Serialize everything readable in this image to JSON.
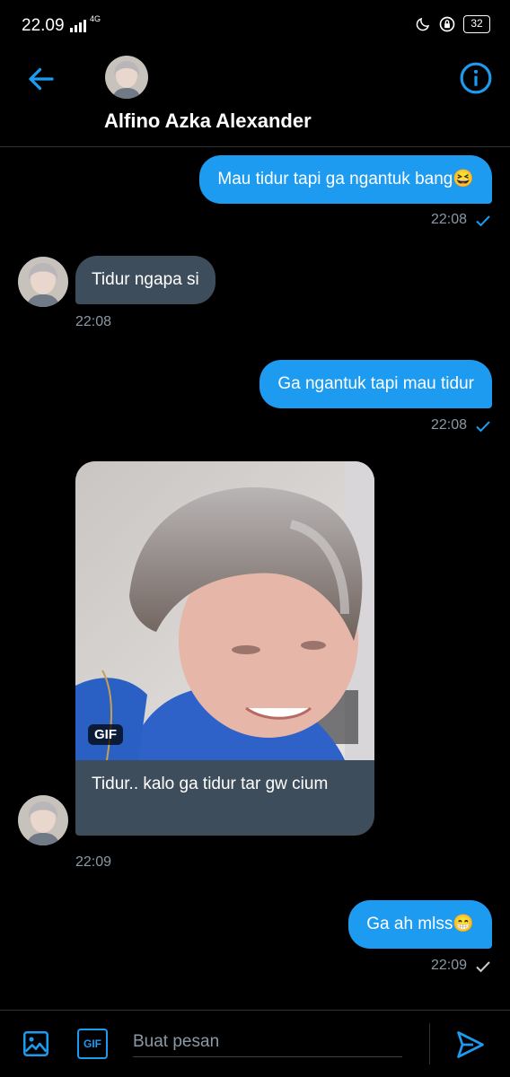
{
  "status_bar": {
    "time": "22.09",
    "network": "4G",
    "battery": "32"
  },
  "header": {
    "contact_name": "Alfino Azka Alexander"
  },
  "messages": [
    {
      "direction": "out",
      "text": "Mau tidur tapi ga ngantuk bang😆",
      "time": "22:08",
      "status": "read"
    },
    {
      "direction": "in",
      "text": "Tidur ngapa si",
      "time": "22:08"
    },
    {
      "direction": "out",
      "text": "Ga ngantuk tapi mau tidur",
      "time": "22:08",
      "status": "read"
    },
    {
      "direction": "in",
      "media_badge": "GIF",
      "text": "Tidur.. kalo ga tidur tar gw cium",
      "time": "22:09"
    },
    {
      "direction": "out",
      "text": "Ga ah mlss😁",
      "time": "22:09",
      "status": "sent"
    }
  ],
  "composer": {
    "placeholder": "Buat pesan",
    "gif_label": "GIF"
  },
  "colors": {
    "accent": "#1d9bf0",
    "incoming_bubble": "#3d4d5c",
    "timestamp": "#8b98a5",
    "background": "#000000"
  },
  "icons": [
    "back-arrow-icon",
    "info-icon",
    "image-icon",
    "gif-icon",
    "send-icon",
    "moon-icon",
    "lock-rotation-icon",
    "signal-icon",
    "check-icon"
  ]
}
